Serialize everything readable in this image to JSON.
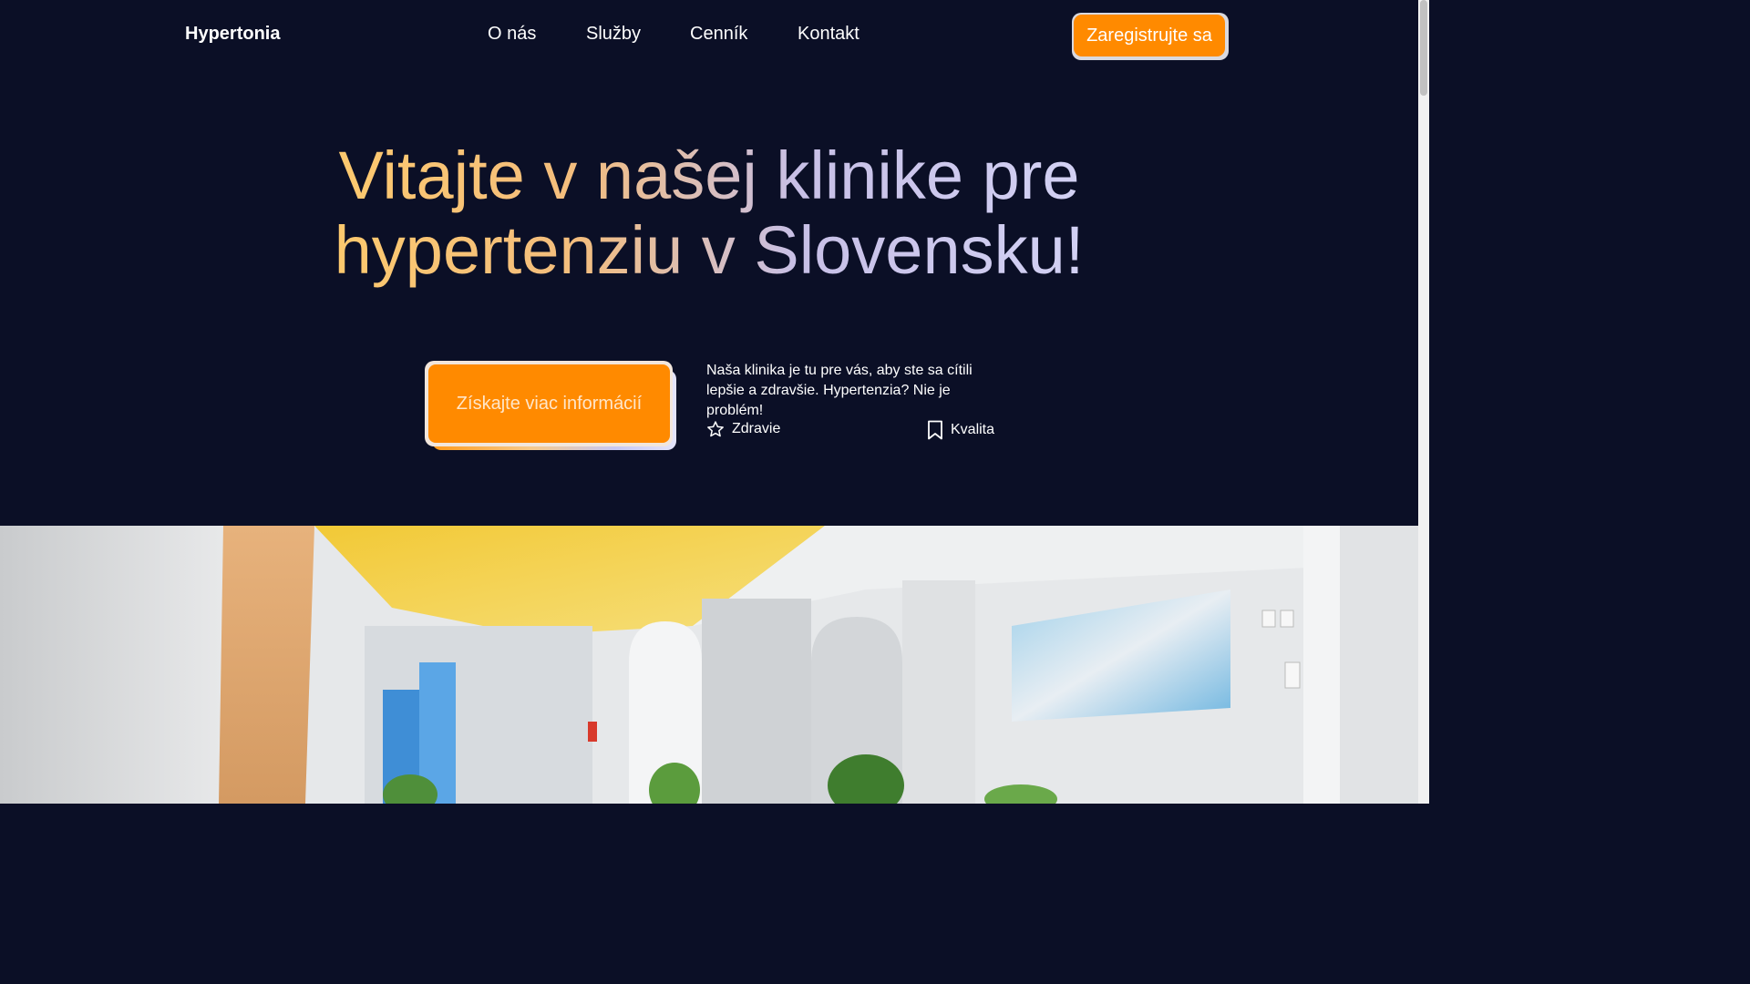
{
  "header": {
    "brand": "Hypertonia",
    "nav": [
      {
        "label": "O nás"
      },
      {
        "label": "Služby"
      },
      {
        "label": "Cenník"
      },
      {
        "label": "Kontakt"
      }
    ],
    "register_label": "Zaregistrujte sa"
  },
  "hero": {
    "title_line1": "Vitajte v našej klinike pre",
    "title_line2": "hypertenziu v Slovensku!",
    "cta_label": "Získajte viac informácií",
    "description": "Naša klinika je tu pre vás, aby ste sa cítili lepšie a zdravšie. Hypertenzia? Nie je problém!",
    "features": [
      {
        "label": "Zdravie",
        "icon": "star-outline-icon"
      },
      {
        "label": "Kvalita",
        "icon": "bookmark-icon"
      }
    ]
  },
  "colors": {
    "background": "#0b0f26",
    "accent": "#ff8a00",
    "text": "#ffffff"
  },
  "image": {
    "subject": "clinic-interior-photo"
  }
}
